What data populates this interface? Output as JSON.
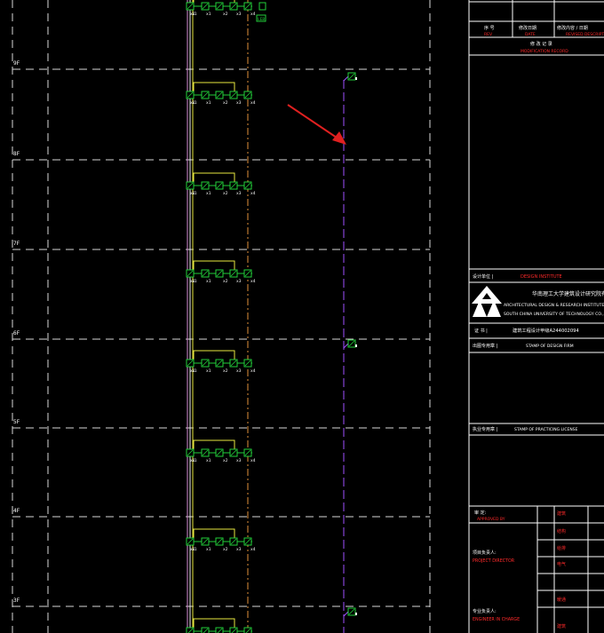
{
  "floors": [
    {
      "label": "9F"
    },
    {
      "label": "8F"
    },
    {
      "label": "7F"
    },
    {
      "label": "6F"
    },
    {
      "label": "5F"
    },
    {
      "label": "4F"
    },
    {
      "label": "3F"
    }
  ],
  "device_row": {
    "tags": [
      "x1",
      "x1",
      "x1",
      "x2",
      "x3",
      "x4"
    ],
    "extra_top_box": "LEB"
  },
  "title_block": {
    "header": {
      "col_no_cn": "序 号",
      "col_no_en": "REV",
      "col_date_cn": "修改日期",
      "col_date_en": "DATE",
      "col_desc_cn": "修改内容 / 日期",
      "col_desc_en": "REVISED DESCRIPTION",
      "record_cn": "修 改 记 录",
      "record_en": "MODIFICATION RECORD"
    },
    "design_unit_cn": "设计单位 |",
    "design_unit_en": "DESIGN INSTITUTE",
    "company_cn": "华南理工大学建筑设计研究院有限公司",
    "company_en_1": "ARCHITECTURAL DESIGN & RESEARCH INSTITUTE",
    "company_en_2": "SOUTH CHINA UNIVERSITY OF TECHNOLOGY CO.,LTD",
    "cert_label": "证 书 |",
    "cert_value": "建筑工程设计甲级A244002094",
    "stamp_design_cn": "出图专用章 |",
    "stamp_design_en": "STAMP OF DESIGN FIRM",
    "stamp_license_cn": "执业专用章 |",
    "stamp_license_en": "STAMP OF PRACTICING LICENSE",
    "approved_cn": "审 定:",
    "approved_en": "APPROVED BY",
    "director_cn": "项目负责人:",
    "director_en": "PROJECT DIRECTOR",
    "engineer_cn": "专业负责人:",
    "engineer_en": "ENGINEER IN CHARGE",
    "sign_labels": [
      "建筑",
      "结构",
      "给排",
      "电气",
      "暖通",
      "建筑"
    ]
  },
  "colors": {
    "grid": "#d9d9d9",
    "device": "#22d03a",
    "magenta": "#d58bd5",
    "orange": "#e0903a",
    "yellow": "#e8e840",
    "arrow": "#e02020",
    "red_text": "#ff2a2a",
    "purple_dash": "#a050ff"
  }
}
